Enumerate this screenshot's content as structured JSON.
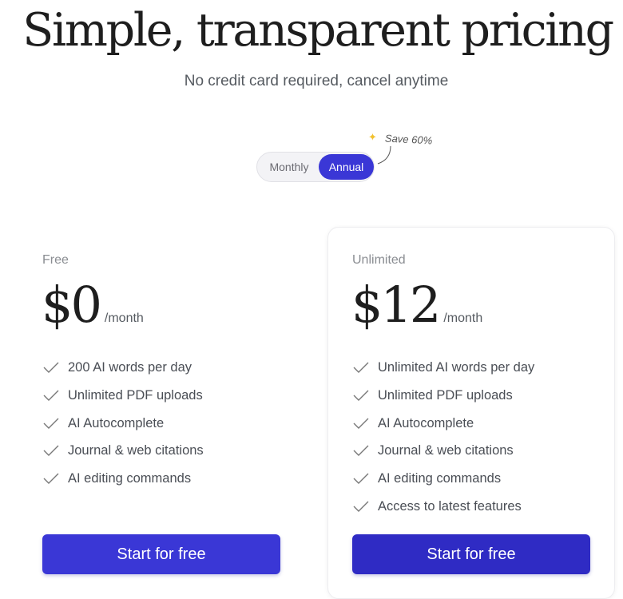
{
  "header": {
    "title": "Simple, transparent pricing",
    "subtitle": "No credit card required, cancel anytime"
  },
  "billing_toggle": {
    "options": [
      "Monthly",
      "Annual"
    ],
    "selected": "Annual",
    "save_note": "Save 60%",
    "save_icon": "sparkle-icon"
  },
  "plans": [
    {
      "name": "Free",
      "price": "$0",
      "period": "/month",
      "features": [
        "200 AI words per day",
        "Unlimited PDF uploads",
        "AI Autocomplete",
        "Journal & web citations",
        "AI editing commands"
      ],
      "cta": "Start for free"
    },
    {
      "name": "Unlimited",
      "price": "$12",
      "period": "/month",
      "features": [
        "Unlimited AI words per day",
        "Unlimited PDF uploads",
        "AI Autocomplete",
        "Journal & web citations",
        "AI editing commands",
        "Access to latest features"
      ],
      "cta": "Start for free"
    }
  ],
  "colors": {
    "accent": "#3a37d6",
    "text": "#1e1e1e",
    "muted": "#8a8d92"
  }
}
